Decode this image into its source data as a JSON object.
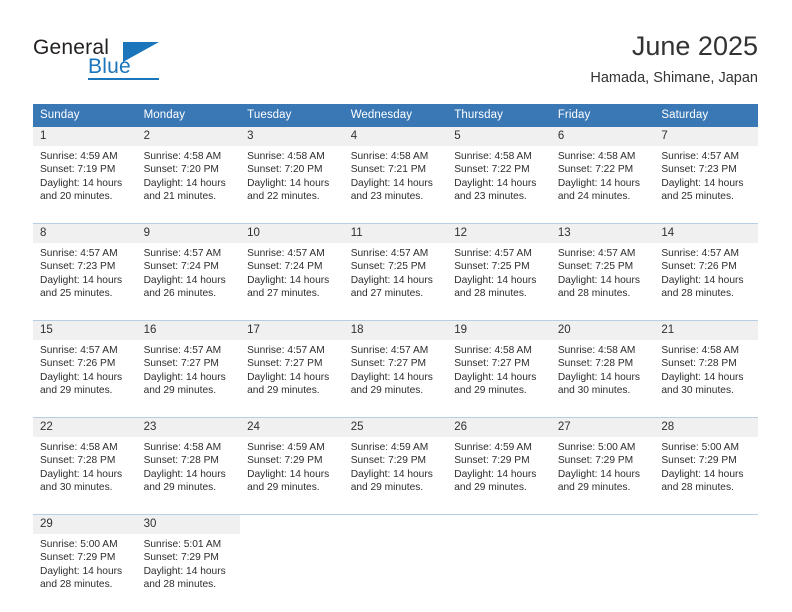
{
  "brand": {
    "name_part1": "General",
    "name_part2": "Blue"
  },
  "header": {
    "title": "June 2025",
    "subtitle": "Hamada, Shimane, Japan"
  },
  "colors": {
    "header_blue": "#3a78b5",
    "brand_blue": "#1b75bb",
    "daynum_bg": "#f0f0f0",
    "row_divider": "#b8cfe3"
  },
  "weekday_headers": [
    "Sunday",
    "Monday",
    "Tuesday",
    "Wednesday",
    "Thursday",
    "Friday",
    "Saturday"
  ],
  "weeks": [
    [
      {
        "day": "1",
        "sunrise": "Sunrise: 4:59 AM",
        "sunset": "Sunset: 7:19 PM",
        "daylight1": "Daylight: 14 hours",
        "daylight2": "and 20 minutes."
      },
      {
        "day": "2",
        "sunrise": "Sunrise: 4:58 AM",
        "sunset": "Sunset: 7:20 PM",
        "daylight1": "Daylight: 14 hours",
        "daylight2": "and 21 minutes."
      },
      {
        "day": "3",
        "sunrise": "Sunrise: 4:58 AM",
        "sunset": "Sunset: 7:20 PM",
        "daylight1": "Daylight: 14 hours",
        "daylight2": "and 22 minutes."
      },
      {
        "day": "4",
        "sunrise": "Sunrise: 4:58 AM",
        "sunset": "Sunset: 7:21 PM",
        "daylight1": "Daylight: 14 hours",
        "daylight2": "and 23 minutes."
      },
      {
        "day": "5",
        "sunrise": "Sunrise: 4:58 AM",
        "sunset": "Sunset: 7:22 PM",
        "daylight1": "Daylight: 14 hours",
        "daylight2": "and 23 minutes."
      },
      {
        "day": "6",
        "sunrise": "Sunrise: 4:58 AM",
        "sunset": "Sunset: 7:22 PM",
        "daylight1": "Daylight: 14 hours",
        "daylight2": "and 24 minutes."
      },
      {
        "day": "7",
        "sunrise": "Sunrise: 4:57 AM",
        "sunset": "Sunset: 7:23 PM",
        "daylight1": "Daylight: 14 hours",
        "daylight2": "and 25 minutes."
      }
    ],
    [
      {
        "day": "8",
        "sunrise": "Sunrise: 4:57 AM",
        "sunset": "Sunset: 7:23 PM",
        "daylight1": "Daylight: 14 hours",
        "daylight2": "and 25 minutes."
      },
      {
        "day": "9",
        "sunrise": "Sunrise: 4:57 AM",
        "sunset": "Sunset: 7:24 PM",
        "daylight1": "Daylight: 14 hours",
        "daylight2": "and 26 minutes."
      },
      {
        "day": "10",
        "sunrise": "Sunrise: 4:57 AM",
        "sunset": "Sunset: 7:24 PM",
        "daylight1": "Daylight: 14 hours",
        "daylight2": "and 27 minutes."
      },
      {
        "day": "11",
        "sunrise": "Sunrise: 4:57 AM",
        "sunset": "Sunset: 7:25 PM",
        "daylight1": "Daylight: 14 hours",
        "daylight2": "and 27 minutes."
      },
      {
        "day": "12",
        "sunrise": "Sunrise: 4:57 AM",
        "sunset": "Sunset: 7:25 PM",
        "daylight1": "Daylight: 14 hours",
        "daylight2": "and 28 minutes."
      },
      {
        "day": "13",
        "sunrise": "Sunrise: 4:57 AM",
        "sunset": "Sunset: 7:25 PM",
        "daylight1": "Daylight: 14 hours",
        "daylight2": "and 28 minutes."
      },
      {
        "day": "14",
        "sunrise": "Sunrise: 4:57 AM",
        "sunset": "Sunset: 7:26 PM",
        "daylight1": "Daylight: 14 hours",
        "daylight2": "and 28 minutes."
      }
    ],
    [
      {
        "day": "15",
        "sunrise": "Sunrise: 4:57 AM",
        "sunset": "Sunset: 7:26 PM",
        "daylight1": "Daylight: 14 hours",
        "daylight2": "and 29 minutes."
      },
      {
        "day": "16",
        "sunrise": "Sunrise: 4:57 AM",
        "sunset": "Sunset: 7:27 PM",
        "daylight1": "Daylight: 14 hours",
        "daylight2": "and 29 minutes."
      },
      {
        "day": "17",
        "sunrise": "Sunrise: 4:57 AM",
        "sunset": "Sunset: 7:27 PM",
        "daylight1": "Daylight: 14 hours",
        "daylight2": "and 29 minutes."
      },
      {
        "day": "18",
        "sunrise": "Sunrise: 4:57 AM",
        "sunset": "Sunset: 7:27 PM",
        "daylight1": "Daylight: 14 hours",
        "daylight2": "and 29 minutes."
      },
      {
        "day": "19",
        "sunrise": "Sunrise: 4:58 AM",
        "sunset": "Sunset: 7:27 PM",
        "daylight1": "Daylight: 14 hours",
        "daylight2": "and 29 minutes."
      },
      {
        "day": "20",
        "sunrise": "Sunrise: 4:58 AM",
        "sunset": "Sunset: 7:28 PM",
        "daylight1": "Daylight: 14 hours",
        "daylight2": "and 30 minutes."
      },
      {
        "day": "21",
        "sunrise": "Sunrise: 4:58 AM",
        "sunset": "Sunset: 7:28 PM",
        "daylight1": "Daylight: 14 hours",
        "daylight2": "and 30 minutes."
      }
    ],
    [
      {
        "day": "22",
        "sunrise": "Sunrise: 4:58 AM",
        "sunset": "Sunset: 7:28 PM",
        "daylight1": "Daylight: 14 hours",
        "daylight2": "and 30 minutes."
      },
      {
        "day": "23",
        "sunrise": "Sunrise: 4:58 AM",
        "sunset": "Sunset: 7:28 PM",
        "daylight1": "Daylight: 14 hours",
        "daylight2": "and 29 minutes."
      },
      {
        "day": "24",
        "sunrise": "Sunrise: 4:59 AM",
        "sunset": "Sunset: 7:29 PM",
        "daylight1": "Daylight: 14 hours",
        "daylight2": "and 29 minutes."
      },
      {
        "day": "25",
        "sunrise": "Sunrise: 4:59 AM",
        "sunset": "Sunset: 7:29 PM",
        "daylight1": "Daylight: 14 hours",
        "daylight2": "and 29 minutes."
      },
      {
        "day": "26",
        "sunrise": "Sunrise: 4:59 AM",
        "sunset": "Sunset: 7:29 PM",
        "daylight1": "Daylight: 14 hours",
        "daylight2": "and 29 minutes."
      },
      {
        "day": "27",
        "sunrise": "Sunrise: 5:00 AM",
        "sunset": "Sunset: 7:29 PM",
        "daylight1": "Daylight: 14 hours",
        "daylight2": "and 29 minutes."
      },
      {
        "day": "28",
        "sunrise": "Sunrise: 5:00 AM",
        "sunset": "Sunset: 7:29 PM",
        "daylight1": "Daylight: 14 hours",
        "daylight2": "and 28 minutes."
      }
    ],
    [
      {
        "day": "29",
        "sunrise": "Sunrise: 5:00 AM",
        "sunset": "Sunset: 7:29 PM",
        "daylight1": "Daylight: 14 hours",
        "daylight2": "and 28 minutes."
      },
      {
        "day": "30",
        "sunrise": "Sunrise: 5:01 AM",
        "sunset": "Sunset: 7:29 PM",
        "daylight1": "Daylight: 14 hours",
        "daylight2": "and 28 minutes."
      },
      {
        "day": "",
        "sunrise": "",
        "sunset": "",
        "daylight1": "",
        "daylight2": ""
      },
      {
        "day": "",
        "sunrise": "",
        "sunset": "",
        "daylight1": "",
        "daylight2": ""
      },
      {
        "day": "",
        "sunrise": "",
        "sunset": "",
        "daylight1": "",
        "daylight2": ""
      },
      {
        "day": "",
        "sunrise": "",
        "sunset": "",
        "daylight1": "",
        "daylight2": ""
      },
      {
        "day": "",
        "sunrise": "",
        "sunset": "",
        "daylight1": "",
        "daylight2": ""
      }
    ]
  ]
}
